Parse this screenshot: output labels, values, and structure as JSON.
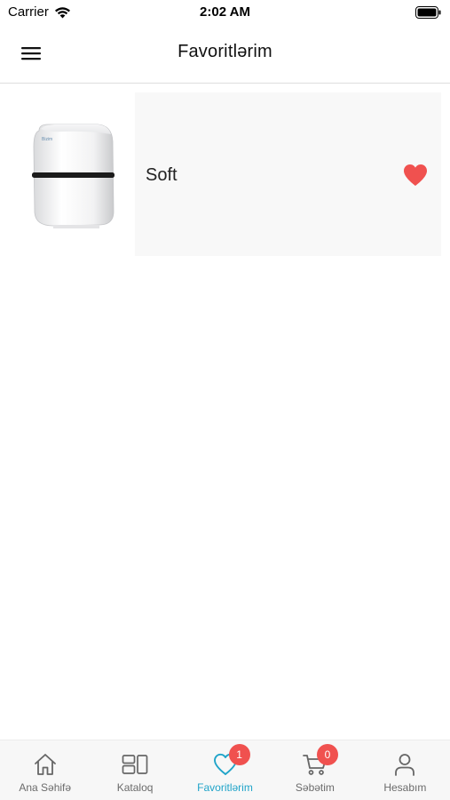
{
  "status_bar": {
    "carrier": "Carrier",
    "time": "2:02 AM",
    "wifi_icon": "wifi-icon",
    "battery_icon": "battery-full-icon"
  },
  "header": {
    "title": "Favoritlərim",
    "menu_icon": "hamburger-menu-icon"
  },
  "favorites": [
    {
      "name": "Soft",
      "favorited": true,
      "heart_color": "#f0514f",
      "image": "white-water-filter-device"
    }
  ],
  "tab_bar": {
    "accent_color": "#20a4c9",
    "tabs": [
      {
        "label": "Ana Səhifə",
        "icon": "home-icon",
        "active": false
      },
      {
        "label": "Kataloq",
        "icon": "catalog-icon",
        "active": false
      },
      {
        "label": "Favoritlərim",
        "icon": "heart-icon",
        "active": true,
        "badge": "1"
      },
      {
        "label": "Səbətim",
        "icon": "cart-icon",
        "active": false,
        "badge": "0"
      },
      {
        "label": "Hesabım",
        "icon": "user-icon",
        "active": false
      }
    ]
  }
}
